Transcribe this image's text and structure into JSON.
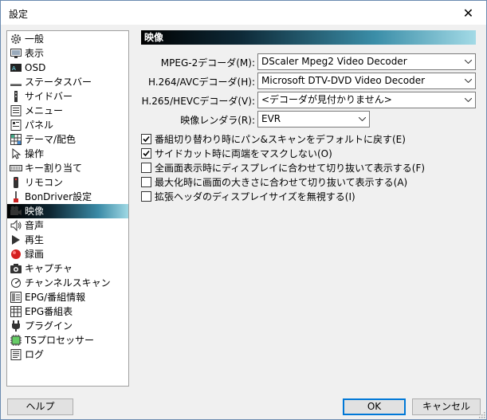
{
  "window": {
    "title": "設定",
    "close_icon": "close-icon"
  },
  "sidebar": {
    "items": [
      {
        "label": "一般",
        "icon": "gear-icon"
      },
      {
        "label": "表示",
        "icon": "display-icon"
      },
      {
        "label": "OSD",
        "icon": "osd-icon"
      },
      {
        "label": "ステータスバー",
        "icon": "statusbar-icon"
      },
      {
        "label": "サイドバー",
        "icon": "sidebar-icon"
      },
      {
        "label": "メニュー",
        "icon": "menu-icon"
      },
      {
        "label": "パネル",
        "icon": "panel-icon"
      },
      {
        "label": "テーマ/配色",
        "icon": "theme-icon"
      },
      {
        "label": "操作",
        "icon": "operation-icon"
      },
      {
        "label": "キー割り当て",
        "icon": "keyboard-icon"
      },
      {
        "label": "リモコン",
        "icon": "remote-icon"
      },
      {
        "label": "BonDriver設定",
        "icon": "bondriver-icon"
      },
      {
        "label": "映像",
        "icon": "video-camera-icon",
        "selected": true
      },
      {
        "label": "音声",
        "icon": "speaker-icon"
      },
      {
        "label": "再生",
        "icon": "play-icon"
      },
      {
        "label": "録画",
        "icon": "record-icon"
      },
      {
        "label": "キャプチャ",
        "icon": "camera-icon"
      },
      {
        "label": "チャンネルスキャン",
        "icon": "scan-icon"
      },
      {
        "label": "EPG/番組情報",
        "icon": "epg-info-icon"
      },
      {
        "label": "EPG番組表",
        "icon": "epg-table-icon"
      },
      {
        "label": "プラグイン",
        "icon": "plugin-icon"
      },
      {
        "label": "TSプロセッサー",
        "icon": "ts-processor-icon"
      },
      {
        "label": "ログ",
        "icon": "log-icon"
      }
    ]
  },
  "main": {
    "section_title": "映像",
    "fields": [
      {
        "label": "MPEG-2デコーダ(M):",
        "value": "DScaler Mpeg2 Video Decoder"
      },
      {
        "label": "H.264/AVCデコーダ(H):",
        "value": "Microsoft DTV-DVD Video Decoder"
      },
      {
        "label": "H.265/HEVCデコーダ(V):",
        "value": "<デコーダが見付かりません>"
      },
      {
        "label": "映像レンダラ(R):",
        "value": "EVR"
      }
    ],
    "checkboxes": [
      {
        "label": "番組切り替わり時にパン&スキャンをデフォルトに戻す(E)",
        "checked": true
      },
      {
        "label": "サイドカット時に両端をマスクしない(O)",
        "checked": true
      },
      {
        "label": "全画面表示時にディスプレイに合わせて切り抜いて表示する(F)",
        "checked": false
      },
      {
        "label": "最大化時に画面の大きさに合わせて切り抜いて表示する(A)",
        "checked": false
      },
      {
        "label": "拡張ヘッダのディスプレイサイズを無視する(I)",
        "checked": false
      }
    ]
  },
  "footer": {
    "help_label": "ヘルプ",
    "ok_label": "OK",
    "cancel_label": "キャンセル"
  },
  "colors": {
    "accent": "#0078d7",
    "selected_gradient_end": "#9fd8e4"
  }
}
